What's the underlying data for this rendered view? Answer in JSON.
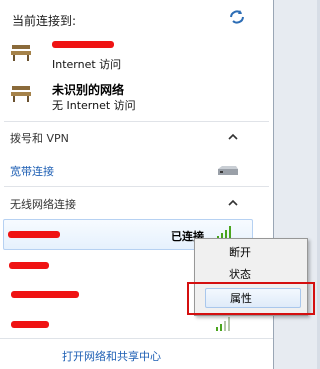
{
  "header": {
    "title": "当前连接到:"
  },
  "connected": [
    {
      "name": "",
      "status": "Internet 访问"
    },
    {
      "name": "未识别的网络",
      "status": "无 Internet 访问"
    }
  ],
  "sections": {
    "dialup": {
      "title": "拨号和 VPN",
      "item": "宽带连接"
    },
    "wireless": {
      "title": "无线网络连接",
      "connected_label": "已连接"
    }
  },
  "context_menu": {
    "items": [
      "断开",
      "状态",
      "属性"
    ],
    "highlighted": "属性"
  },
  "footer": {
    "link": "打开网络和共享中心"
  },
  "colors": {
    "link": "#1e5fb4",
    "redaction": "#ef1313",
    "signal": "#4aa51e",
    "highlight_box": "#d40f0f"
  }
}
